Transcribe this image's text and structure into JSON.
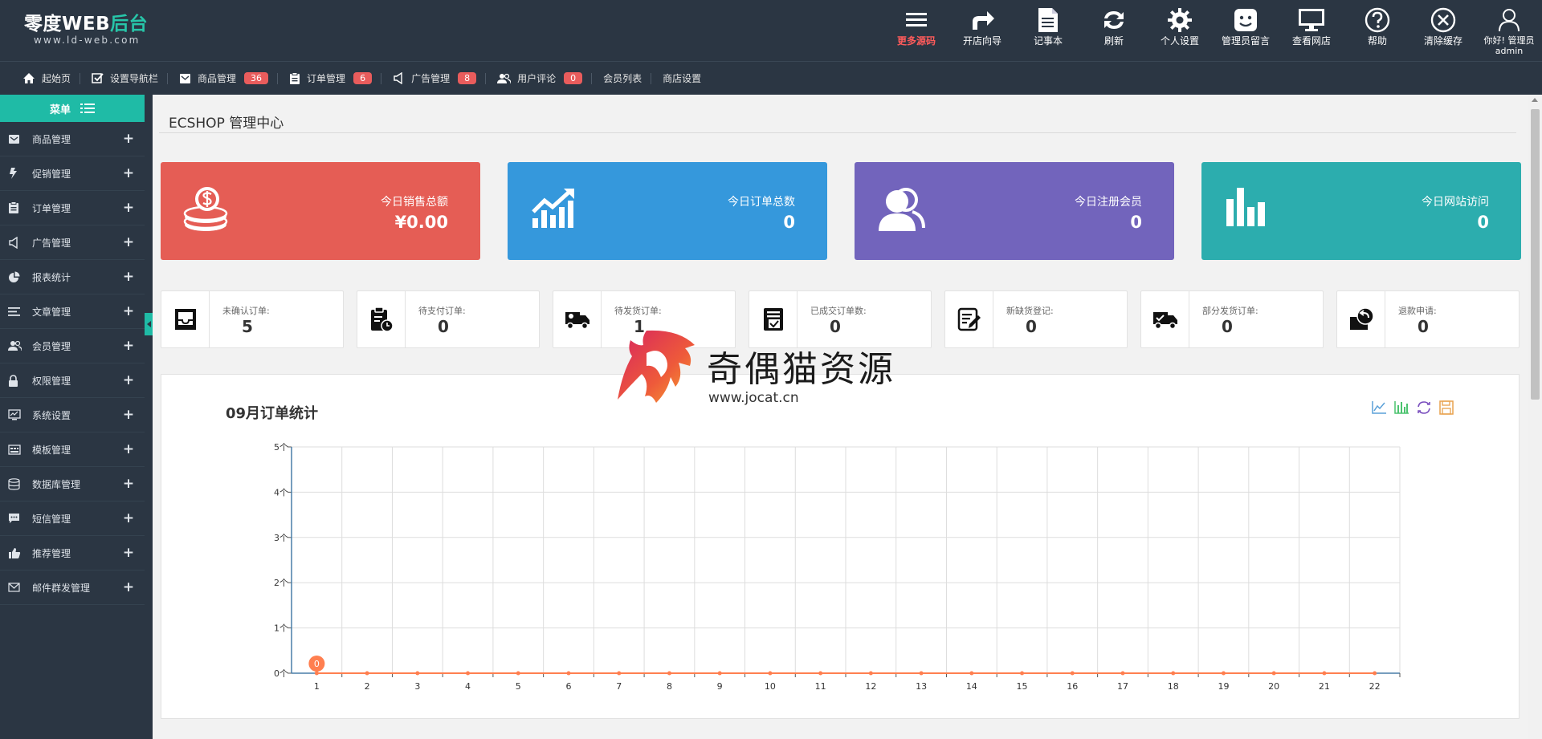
{
  "brand": {
    "title_main": "零度WEB",
    "title_accent": "后台",
    "subtitle": "www.ld-web.com",
    "accent_color": "#27c6a9"
  },
  "topnav": [
    {
      "icon": "menu-icon",
      "label": "更多源码",
      "highlight": true
    },
    {
      "icon": "share-arrow-icon",
      "label": "开店向导"
    },
    {
      "icon": "notepad-icon",
      "label": "记事本"
    },
    {
      "icon": "refresh-icon",
      "label": "刷新"
    },
    {
      "icon": "gear-icon",
      "label": "个人设置"
    },
    {
      "icon": "message-icon",
      "label": "管理员留言"
    },
    {
      "icon": "monitor-icon",
      "label": "查看网店"
    },
    {
      "icon": "help-icon",
      "label": "帮助"
    },
    {
      "icon": "clear-cache-icon",
      "label": "清除缓存"
    }
  ],
  "user": {
    "greeting": "你好! 管理员",
    "name": "admin",
    "icon": "user-icon"
  },
  "quickbar": [
    {
      "icon": "home-icon",
      "label": "起始页"
    },
    {
      "icon": "checkbox-icon",
      "label": "设置导航栏"
    },
    {
      "icon": "mail-icon",
      "label": "商品管理",
      "badge": "36"
    },
    {
      "icon": "clipboard-icon",
      "label": "订单管理",
      "badge": "6"
    },
    {
      "icon": "megaphone-icon",
      "label": "广告管理",
      "badge": "8"
    },
    {
      "icon": "users-icon",
      "label": "用户评论",
      "badge": "0"
    },
    {
      "label": "会员列表"
    },
    {
      "label": "商店设置"
    }
  ],
  "sidebar": {
    "title": "菜单",
    "items": [
      {
        "icon": "mail-icon",
        "label": "商品管理"
      },
      {
        "icon": "flash-icon",
        "label": "促销管理"
      },
      {
        "icon": "clipboard-icon",
        "label": "订单管理"
      },
      {
        "icon": "megaphone-icon",
        "label": "广告管理"
      },
      {
        "icon": "pie-chart-icon",
        "label": "报表统计"
      },
      {
        "icon": "article-icon",
        "label": "文章管理"
      },
      {
        "icon": "users-icon",
        "label": "会员管理"
      },
      {
        "icon": "lock-icon",
        "label": "权限管理"
      },
      {
        "icon": "monitor-chart-icon",
        "label": "系统设置"
      },
      {
        "icon": "template-icon",
        "label": "模板管理"
      },
      {
        "icon": "database-icon",
        "label": "数据库管理"
      },
      {
        "icon": "sms-icon",
        "label": "短信管理"
      },
      {
        "icon": "thumbs-up-icon",
        "label": "推荐管理"
      },
      {
        "icon": "envelope-icon",
        "label": "邮件群发管理"
      }
    ]
  },
  "page_title": "ECSHOP 管理中心",
  "stats": [
    {
      "icon": "coins-icon",
      "label": "今日销售总额",
      "value": "¥0.00",
      "color": "#e55d55"
    },
    {
      "icon": "trend-chart-icon",
      "label": "今日订单总数",
      "value": "0",
      "color": "#3598dc"
    },
    {
      "icon": "member-icon",
      "label": "今日注册会员",
      "value": "0",
      "color": "#7264bc"
    },
    {
      "icon": "bar-chart-icon",
      "label": "今日网站访问",
      "value": "0",
      "color": "#2cadae"
    }
  ],
  "order_stats": [
    {
      "icon": "inbox-icon",
      "label": "未确认订单:",
      "value": "5"
    },
    {
      "icon": "pay-clock-icon",
      "label": "待支付订单:",
      "value": "0"
    },
    {
      "icon": "truck-icon",
      "label": "待发货订单:",
      "value": "1"
    },
    {
      "icon": "invoice-check-icon",
      "label": "已成交订单数:",
      "value": "0"
    },
    {
      "icon": "edit-note-icon",
      "label": "新缺货登记:",
      "value": "0"
    },
    {
      "icon": "truck-partial-icon",
      "label": "部分发货订单:",
      "value": "0"
    },
    {
      "icon": "refund-icon",
      "label": "退款申请:",
      "value": "0"
    }
  ],
  "chart_tools": [
    "line-chart-icon",
    "bar-chart-icon",
    "restore-icon",
    "save-icon"
  ],
  "watermark": {
    "text": "奇偶猫资源",
    "url": "www.jocat.cn"
  },
  "chart_data": {
    "type": "line",
    "title": "09月订单统计",
    "x": [
      "1",
      "2",
      "3",
      "4",
      "5",
      "6",
      "7",
      "8",
      "9",
      "10",
      "11",
      "12",
      "13",
      "14",
      "15",
      "16",
      "17",
      "18",
      "19",
      "20",
      "21",
      "22"
    ],
    "series": [
      {
        "values": [
          0,
          0,
          0,
          0,
          0,
          0,
          0,
          0,
          0,
          0,
          0,
          0,
          0,
          0,
          0,
          0,
          0,
          0,
          0,
          0,
          0,
          0
        ]
      }
    ],
    "yticks": [
      "0个",
      "1个",
      "2个",
      "3个",
      "4个",
      "5个"
    ],
    "ylim": [
      0,
      5
    ],
    "data_label": {
      "index": 0,
      "text": "0"
    },
    "line_color": "#ff7f50",
    "grid": true
  }
}
